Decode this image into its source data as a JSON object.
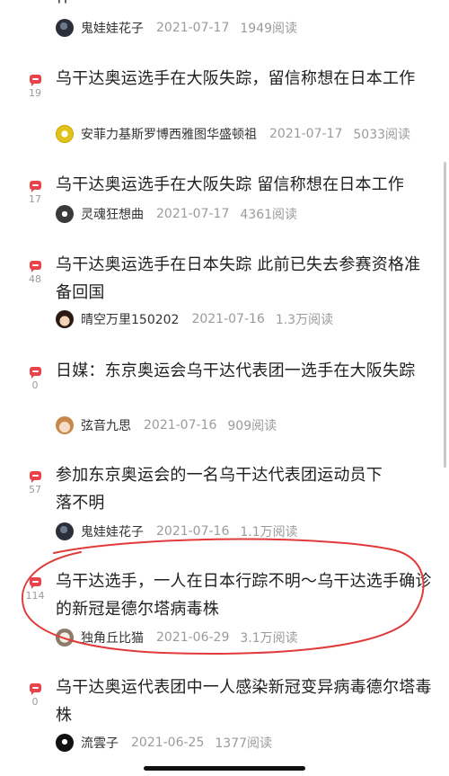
{
  "top_partial_title": "作",
  "items": [
    {
      "title": "",
      "author": "鬼娃娃花子",
      "date": "2021-07-17",
      "reads": "1949阅读",
      "comments": "",
      "avatar": "ghost-avatar"
    },
    {
      "title": "乌干达奥运选手在大阪失踪，留信称想在日本工作",
      "author": "安菲力基斯罗博西雅图华盛顿祖",
      "date": "2021-07-17",
      "reads": "5033阅读",
      "comments": "19",
      "avatar": "yellow-avatar"
    },
    {
      "title": "乌干达奥运选手在大阪失踪 留信称想在日本工作",
      "author": "灵魂狂想曲",
      "date": "2021-07-17",
      "reads": "4361阅读",
      "comments": "17",
      "avatar": "dark-avatar"
    },
    {
      "title": "乌干达奥运选手在日本失踪 此前已失去参赛资格准备回国",
      "author": "晴空万里150202",
      "date": "2021-07-16",
      "reads": "1.3万阅读",
      "comments": "48",
      "avatar": "anime-avatar"
    },
    {
      "title": "日媒：东京奥运会乌干达代表团一选手在大阪失踪",
      "author": "弦音九思",
      "date": "2021-07-16",
      "reads": "909阅读",
      "comments": "0",
      "avatar": "girl-avatar"
    },
    {
      "title": "参加东京奥运会的一名乌干达代表团运动员下落不明",
      "author": "鬼娃娃花子",
      "date": "2021-07-16",
      "reads": "1.1万阅读",
      "comments": "57",
      "avatar": "ghost-avatar"
    },
    {
      "title": "乌干达选手，一人在日本行踪不明～乌干达选手确诊的新冠是德尔塔病毒株",
      "author": "独角丘比猫",
      "date": "2021-06-29",
      "reads": "3.1万阅读",
      "comments": "114",
      "avatar": "unicorn-avatar"
    },
    {
      "title": "乌干达奥运代表团中一人感染新冠变异病毒德尔塔毒株",
      "author": "流雲子",
      "date": "2021-06-25",
      "reads": "1377阅读",
      "comments": "0",
      "avatar": "bw-avatar"
    }
  ],
  "colors": {
    "comment_icon": "#e8424a",
    "annotation_circle": "#e03a3a",
    "meta_text": "#9b9b9b"
  }
}
